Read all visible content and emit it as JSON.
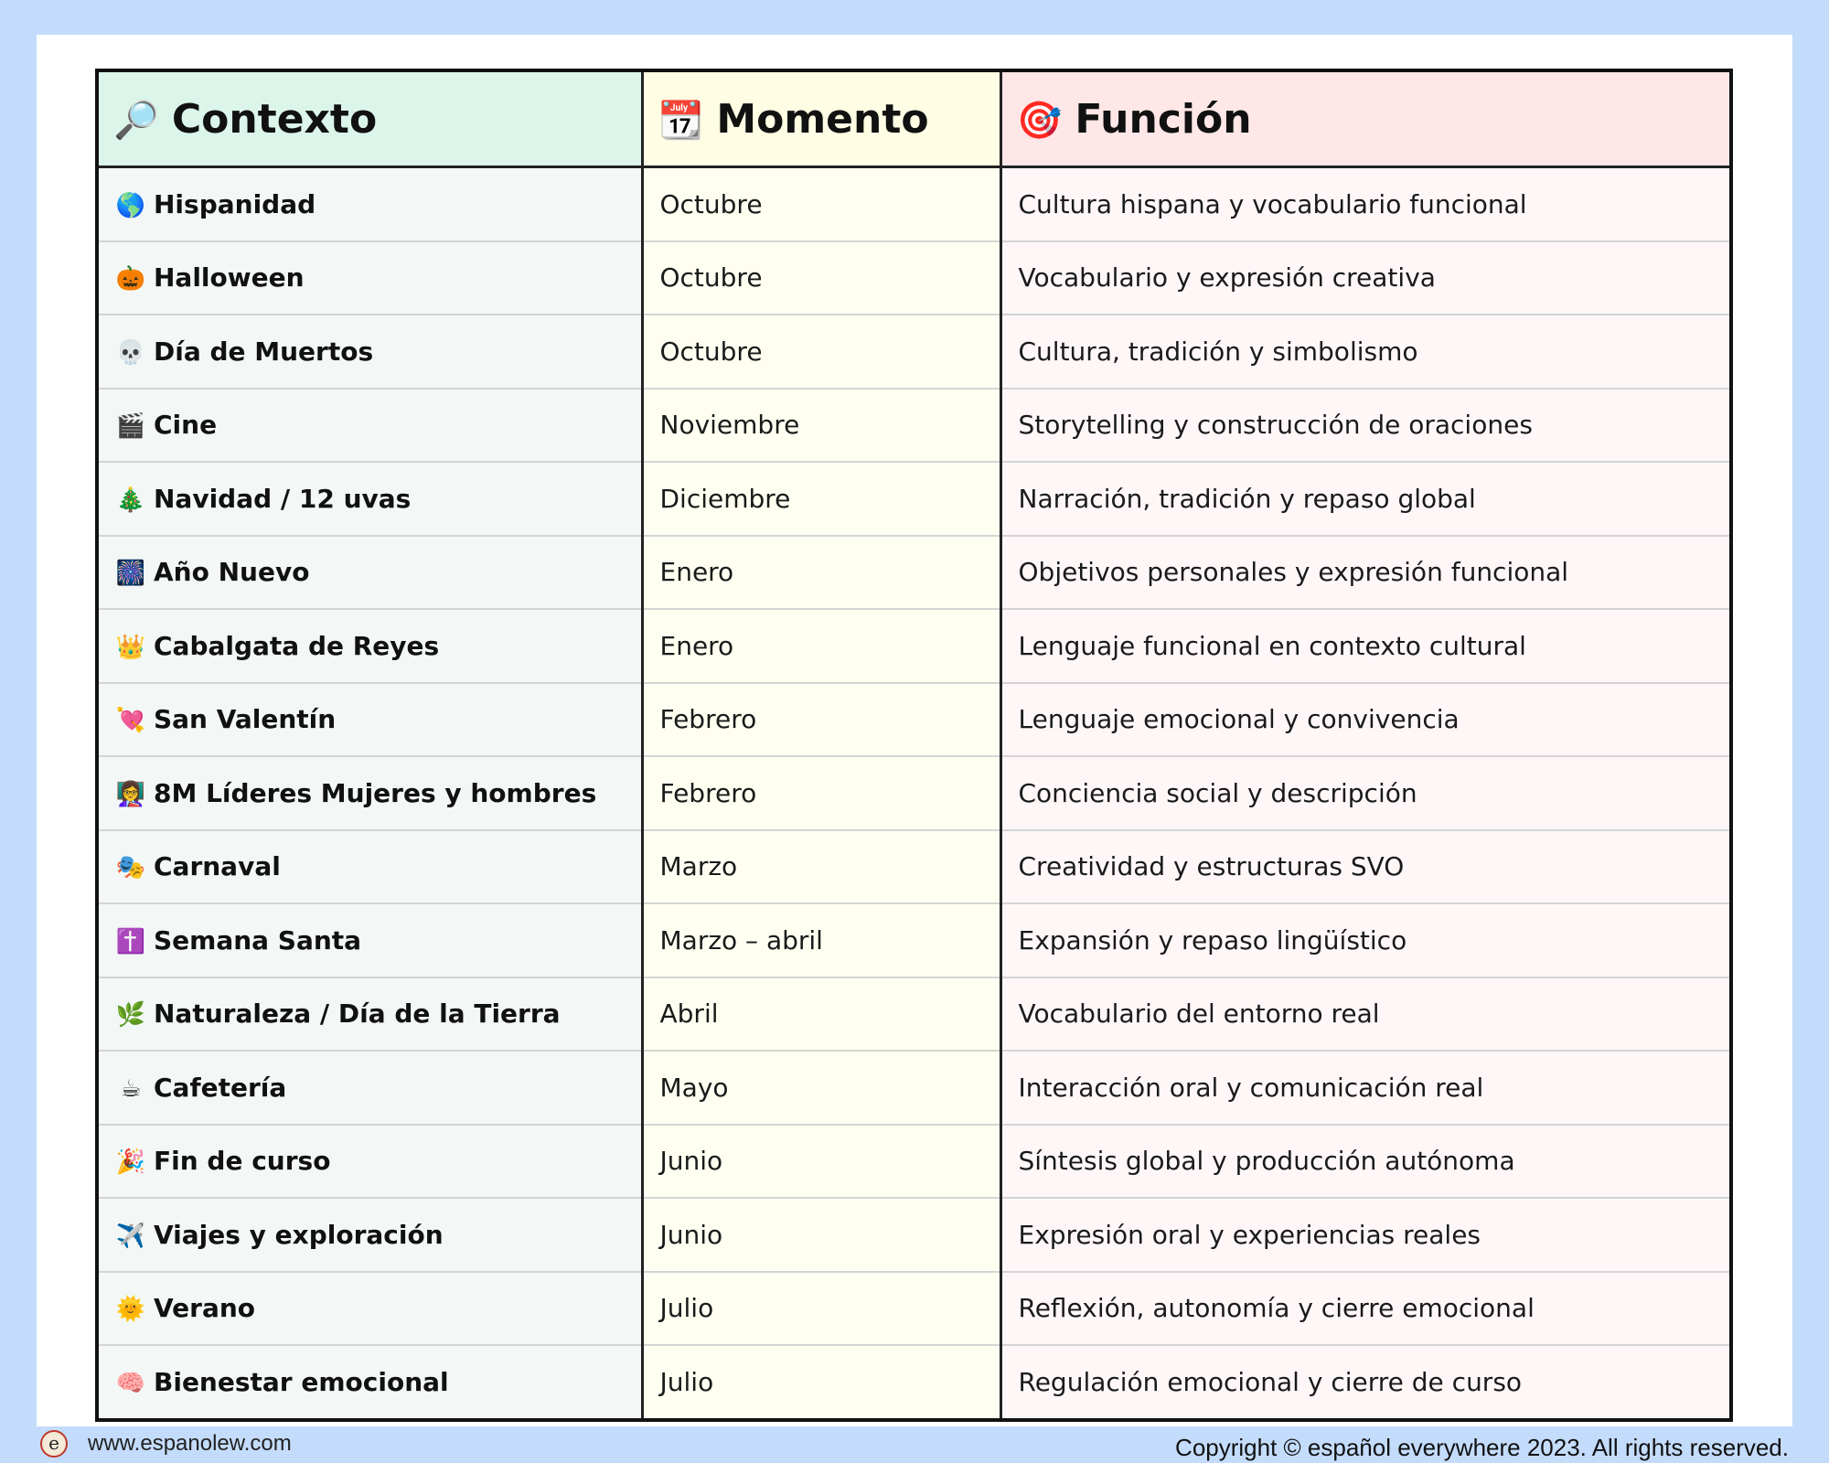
{
  "table": {
    "headers": [
      {
        "icon": "🔎",
        "label": "Contexto"
      },
      {
        "icon": "📆",
        "label": "Momento"
      },
      {
        "icon": "🎯",
        "label": "Función"
      }
    ],
    "rows": [
      {
        "icon": "🌎",
        "context": "Hispanidad",
        "moment": "Octubre",
        "function": "Cultura hispana y vocabulario funcional"
      },
      {
        "icon": "🎃",
        "context": "Halloween",
        "moment": "Octubre",
        "function": "Vocabulario y expresión creativa"
      },
      {
        "icon": "💀",
        "context": "Día de Muertos",
        "moment": "Octubre",
        "function": "Cultura, tradición y simbolismo"
      },
      {
        "icon": "🎬",
        "context": "Cine",
        "moment": "Noviembre",
        "function": "Storytelling y construcción de oraciones"
      },
      {
        "icon": "🎄",
        "context": "Navidad / 12 uvas",
        "moment": "Diciembre",
        "function": "Narración, tradición y repaso global"
      },
      {
        "icon": "🎆",
        "context": "Año Nuevo",
        "moment": "Enero",
        "function": "Objetivos personales y expresión funcional"
      },
      {
        "icon": "👑",
        "context": "Cabalgata de Reyes",
        "moment": "Enero",
        "function": "Lenguaje funcional en contexto cultural"
      },
      {
        "icon": "💘",
        "context": "San Valentín",
        "moment": "Febrero",
        "function": "Lenguaje emocional y convivencia"
      },
      {
        "icon": "👩‍🏫",
        "context": "8M Líderes Mujeres y hombres",
        "moment": "Febrero",
        "function": "Conciencia social y descripción"
      },
      {
        "icon": "🎭",
        "context": "Carnaval",
        "moment": "Marzo",
        "function": "Creatividad y estructuras SVO"
      },
      {
        "icon": "✝️",
        "context": "Semana Santa",
        "moment": "Marzo – abril",
        "function": "Expansión y repaso lingüístico"
      },
      {
        "icon": "🌿",
        "context": "Naturaleza / Día de la Tierra",
        "moment": "Abril",
        "function": "Vocabulario del entorno real"
      },
      {
        "icon": "☕",
        "context": "Cafetería",
        "moment": "Mayo",
        "function": "Interacción oral y comunicación real"
      },
      {
        "icon": "🎉",
        "context": "Fin de curso",
        "moment": "Junio",
        "function": "Síntesis global y producción autónoma"
      },
      {
        "icon": "✈️",
        "context": "Viajes y exploración",
        "moment": "Junio",
        "function": "Expresión oral y experiencias reales"
      },
      {
        "icon": "🌞",
        "context": "Verano",
        "moment": "Julio",
        "function": "Reflexión, autonomía y cierre emocional"
      },
      {
        "icon": "🧠",
        "context": "Bienestar emocional",
        "moment": "Julio",
        "function": "Regulación emocional y cierre de curso"
      }
    ]
  },
  "footer": {
    "logo_letter": "e",
    "website": "www.espanolew.com",
    "copyright": "Copyright © español everywhere 2023. All rights reserved."
  }
}
